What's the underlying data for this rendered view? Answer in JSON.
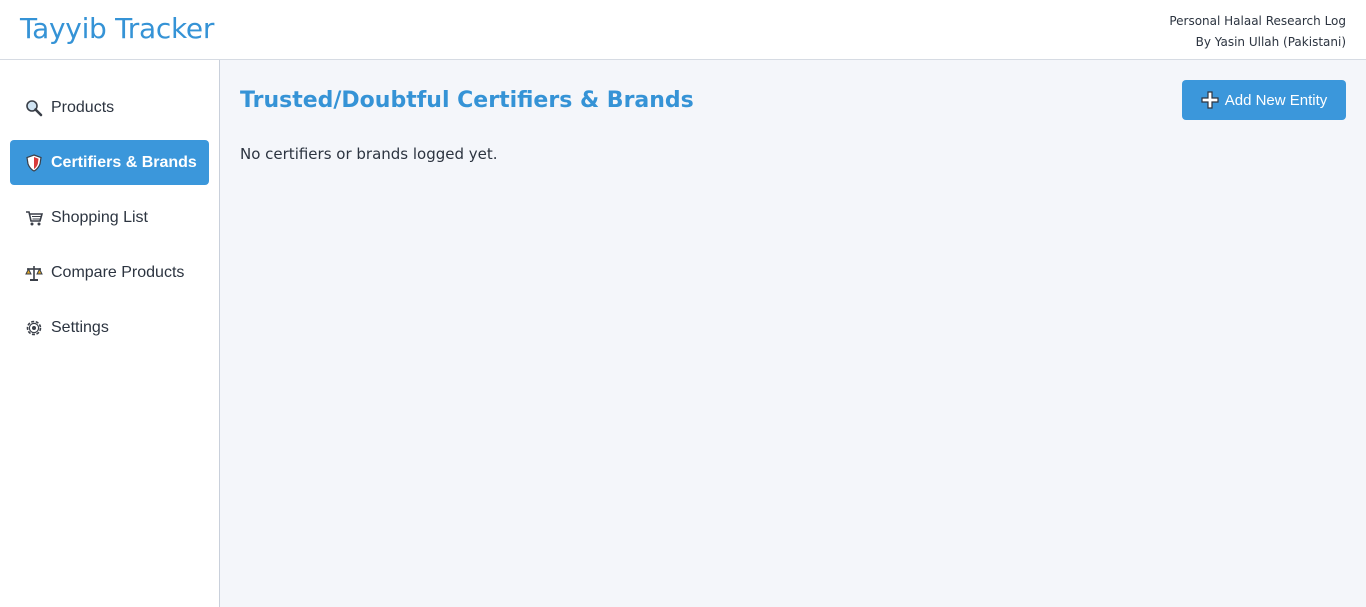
{
  "header": {
    "app_title": "Tayyib Tracker",
    "subtitle_line1": "Personal Halaal Research Log",
    "subtitle_line2": "By Yasin Ullah (Pakistani)"
  },
  "sidebar": {
    "items": [
      {
        "label": "Products",
        "icon": "magnifier-icon",
        "active": false
      },
      {
        "label": "Certifiers & Brands",
        "icon": "shield-icon",
        "active": true
      },
      {
        "label": "Shopping List",
        "icon": "cart-icon",
        "active": false
      },
      {
        "label": "Compare Products",
        "icon": "scales-icon",
        "active": false
      },
      {
        "label": "Settings",
        "icon": "gear-icon",
        "active": false
      }
    ]
  },
  "main": {
    "title": "Trusted/Doubtful Certifiers & Brands",
    "add_button_label": "Add New Entity",
    "add_button_icon": "plus-icon",
    "empty_message": "No certifiers or brands logged yet."
  },
  "colors": {
    "accent": "#3b97db",
    "title": "#3593d6",
    "background": "#f4f6fa"
  }
}
